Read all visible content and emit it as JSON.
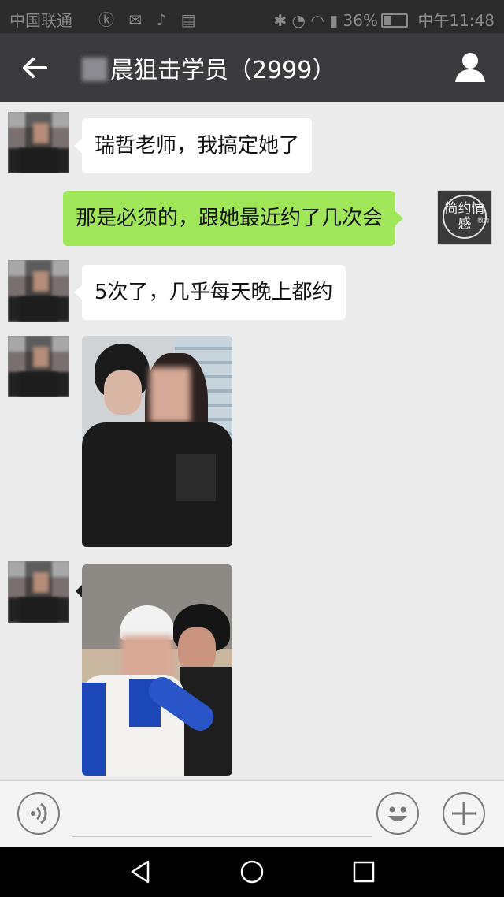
{
  "status_bar": {
    "carrier": "中国联通",
    "battery": "36%",
    "time": "中午11:48"
  },
  "header": {
    "title": "晨狙击学员（2999）",
    "back_icon": "back-arrow-icon",
    "info_icon": "user-icon"
  },
  "messages": [
    {
      "direction": "in",
      "type": "text",
      "text": "瑞哲老师，我搞定她了"
    },
    {
      "direction": "out",
      "type": "text",
      "text": "那是必须的，跟她最近约了几次会"
    },
    {
      "direction": "in",
      "type": "text",
      "text": "5次了，几乎每天晚上都约"
    },
    {
      "direction": "in",
      "type": "image"
    },
    {
      "direction": "in",
      "type": "image"
    }
  ],
  "my_avatar": {
    "logo_text": "简约情感",
    "tiny_text": "教育"
  },
  "input_bar": {
    "voice_icon": "voice-icon",
    "emoji_icon": "emoji-icon",
    "plus_icon": "plus-icon"
  },
  "nav_bar": {
    "back": "nav-back-icon",
    "home": "nav-home-icon",
    "recents": "nav-recents-icon"
  }
}
